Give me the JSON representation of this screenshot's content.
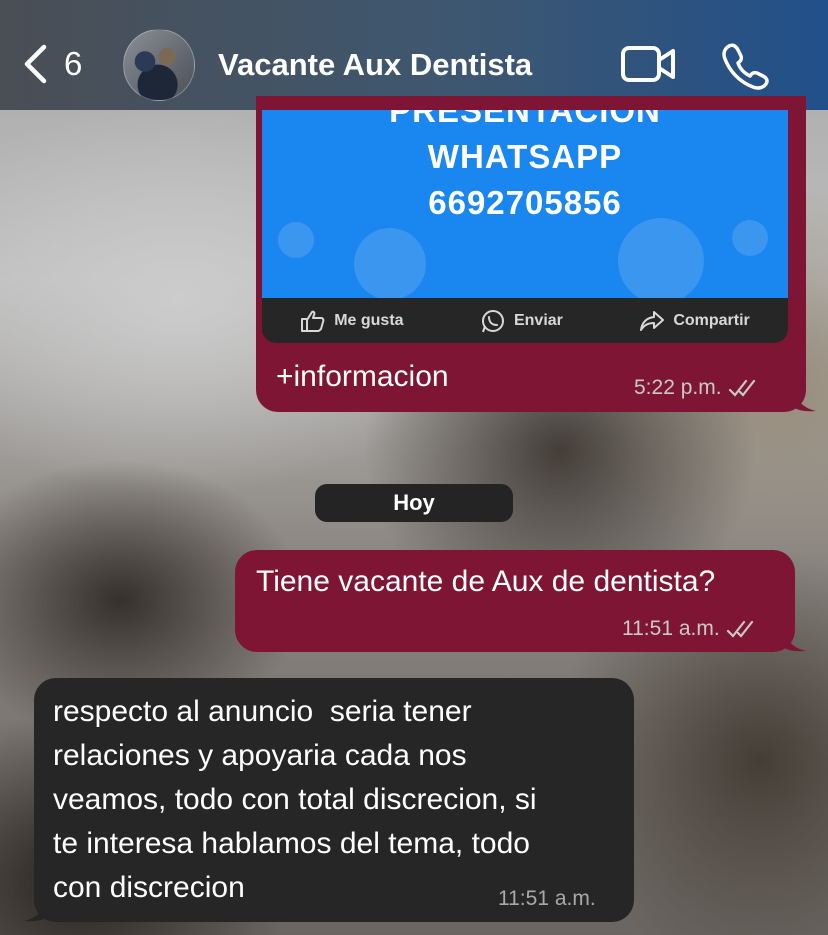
{
  "header": {
    "back_count": "6",
    "title": "Vacante Aux Dentista",
    "icons": [
      "chevron-left-icon",
      "video-call-icon",
      "phone-icon"
    ]
  },
  "messages": [
    {
      "direction": "outgoing",
      "ad_card": {
        "line1": "PRESENTACION",
        "line2": "WHATSAPP",
        "line3": "6692705856",
        "actions": [
          "Me gusta",
          "Enviar",
          "Compartir"
        ]
      },
      "text": "+informacion",
      "time": "5:22 p.m.",
      "status": "read"
    },
    {
      "direction": "outgoing",
      "text": "Tiene vacante de Aux de dentista?",
      "time": "11:51 a.m.",
      "status": "read"
    },
    {
      "direction": "incoming",
      "text": "respecto al anuncio  seria tener\nrelaciones y apoyaria cada nos\nveamos, todo con total discrecion, si\nte interesa hablamos del tema, todo\ncon discrecion",
      "time": "11:51 a.m."
    }
  ],
  "date_separator": "Hoy",
  "colors": {
    "outgoing_bubble": "#7e1534",
    "incoming_bubble": "#262626",
    "ad_blue": "#1a86ef",
    "header_end": "#21508a"
  }
}
